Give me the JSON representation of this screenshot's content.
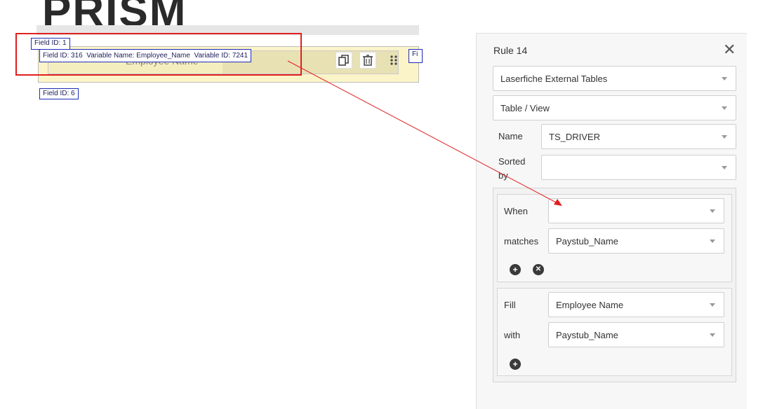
{
  "canvas": {
    "logo_text": "PRISM",
    "field1_tag": "Field ID: 1",
    "main_tag": {
      "field_id_label": "Field ID:",
      "field_id": "316",
      "variable_name_label": "Variable Name:",
      "variable_name": "Employee_Name",
      "variable_id_label": "Variable ID:",
      "variable_id": "7241"
    },
    "field_label": "Employee Name",
    "side_tag": "Fi",
    "field6_tag": "Field ID: 6"
  },
  "panel": {
    "title": "Rule 14",
    "source_select": "Laserfiche External Tables",
    "type_select": "Table / View",
    "name_label": "Name",
    "name_value": "TS_DRIVER",
    "sorted_label": "Sorted by",
    "sorted_value": "",
    "when_label": "When",
    "when_value": "",
    "matches_label": "matches",
    "matches_value": "Paystub_Name",
    "fill_label": "Fill",
    "fill_value": "Employee Name",
    "with_label": "with",
    "with_value": "Paystub_Name"
  },
  "colors": {
    "annotation_red": "#e02020",
    "tag_border_blue": "#1c2bb8",
    "field_highlight": "#fbf4c8"
  }
}
